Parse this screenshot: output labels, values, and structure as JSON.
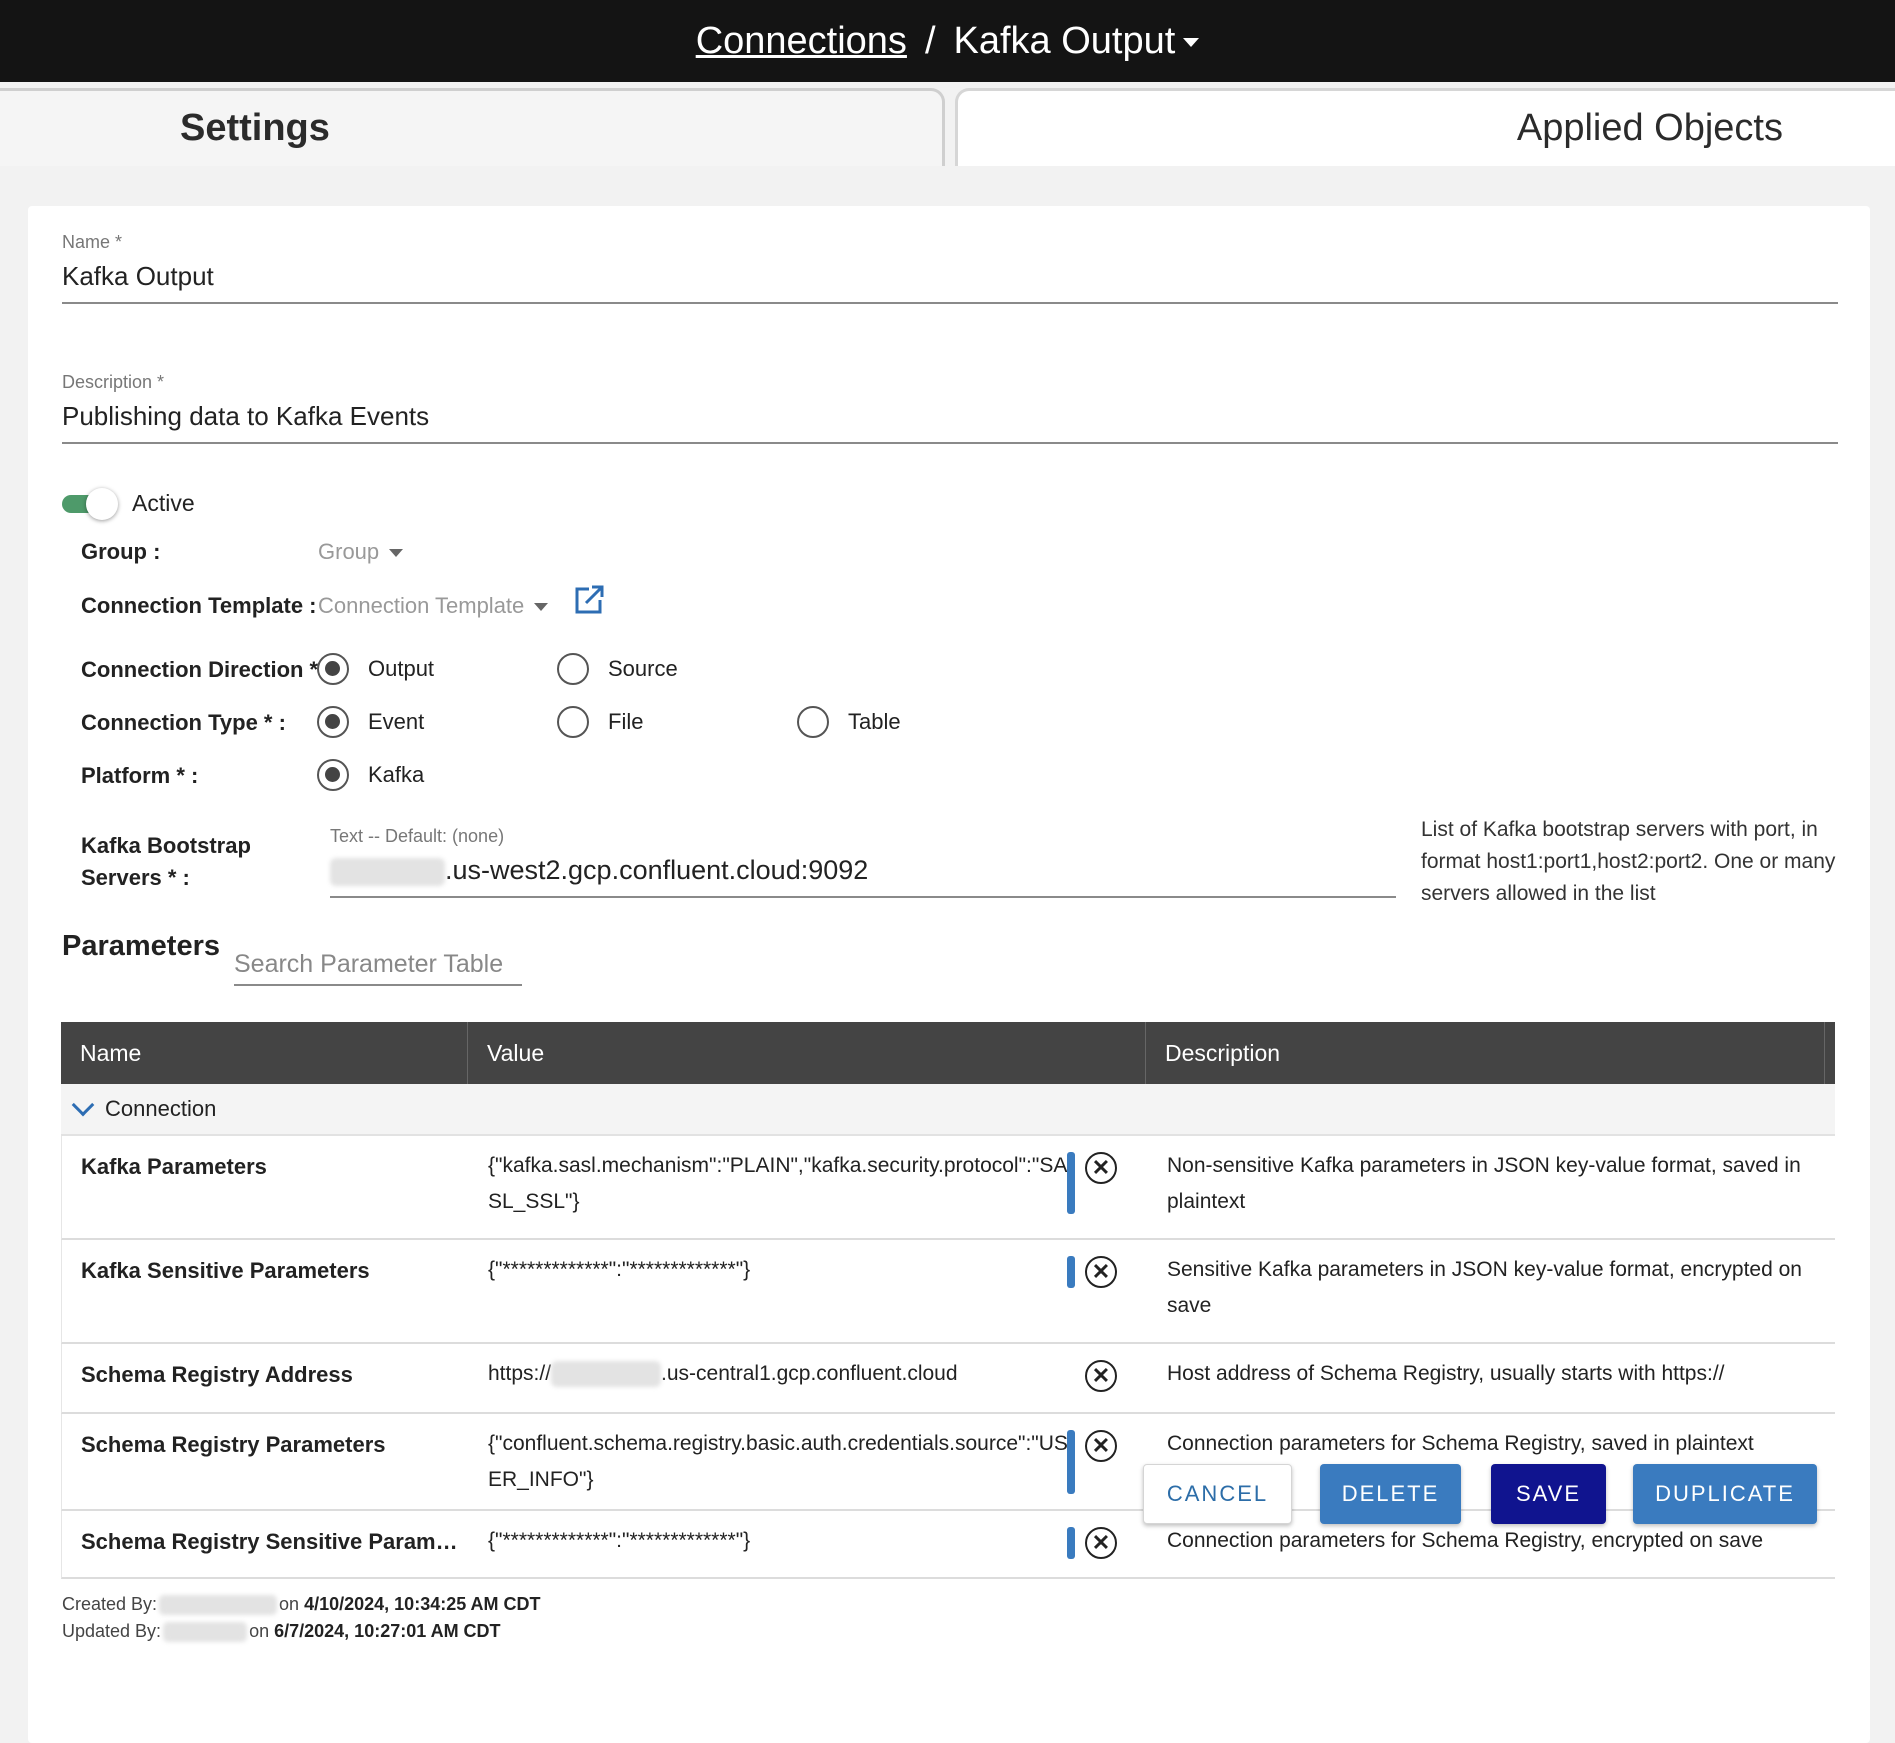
{
  "header": {
    "breadcrumb_link": "Connections",
    "separator": "/",
    "current": "Kafka Output"
  },
  "tabs": {
    "settings": "Settings",
    "applied_objects": "Applied Objects"
  },
  "form": {
    "name_label": "Name *",
    "name_value": "Kafka Output",
    "description_label": "Description *",
    "description_value": "Publishing data to Kafka Events",
    "active_label": "Active",
    "active": true,
    "group_label": "Group :",
    "group_placeholder": "Group",
    "template_label": "Connection Template :",
    "template_placeholder": "Connection Template",
    "direction_label": "Connection Direction * :",
    "direction_options": [
      "Output",
      "Source"
    ],
    "direction_selected": "Output",
    "type_label": "Connection Type * :",
    "type_options": [
      "Event",
      "File",
      "Table"
    ],
    "type_selected": "Event",
    "platform_label": "Platform * :",
    "platform_options": [
      "Kafka"
    ],
    "platform_selected": "Kafka",
    "bootstrap_label": "Kafka Bootstrap Servers * :",
    "bootstrap_hint": "Text -- Default: (none)",
    "bootstrap_value_suffix": ".us-west2.gcp.confluent.cloud:9092",
    "bootstrap_help": "List of Kafka bootstrap servers with port, in format host1:port1,host2:port2. One or many servers allowed in the list"
  },
  "parameters": {
    "title": "Parameters",
    "search_placeholder": "Search Parameter Table",
    "columns": [
      "Name",
      "Value",
      "Description"
    ],
    "group": "Connection",
    "rows": [
      {
        "name": "Kafka Parameters",
        "value": "{\"kafka.sasl.mechanism\":\"PLAIN\",\"kafka.security.protocol\":\"SASL_SSL\"}",
        "description": "Non-sensitive Kafka parameters in JSON key-value format, saved in plaintext"
      },
      {
        "name": "Kafka Sensitive Parameters",
        "value": "{\"*************\":\"*************\"}",
        "description": "Sensitive Kafka parameters in JSON key-value format, encrypted on save"
      },
      {
        "name": "Schema Registry Address",
        "value_prefix": "https://",
        "value_suffix": ".us-central1.gcp.confluent.cloud",
        "description": "Host address of Schema Registry, usually starts with https://"
      },
      {
        "name": "Schema Registry Parameters",
        "value": "{\"confluent.schema.registry.basic.auth.credentials.source\":\"USER_INFO\"}",
        "description": "Connection parameters for Schema Registry, saved in plaintext"
      },
      {
        "name": "Schema Registry Sensitive Paramet...",
        "value": "{\"*************\":\"*************\"}",
        "description": "Connection parameters for Schema Registry, encrypted on save"
      }
    ]
  },
  "audit": {
    "created_label": "Created By:",
    "created_on": "on",
    "created_date": "4/10/2024, 10:34:25 AM CDT",
    "updated_label": "Updated By:",
    "updated_on": "on",
    "updated_date": "6/7/2024, 10:27:01 AM CDT"
  },
  "buttons": {
    "cancel": "CANCEL",
    "delete": "DELETE",
    "save": "SAVE",
    "duplicate": "DUPLICATE"
  },
  "colors": {
    "accent": "#3a7bbf",
    "save": "#10148f",
    "toggle": "#4e9a6a",
    "header": "#141414"
  }
}
